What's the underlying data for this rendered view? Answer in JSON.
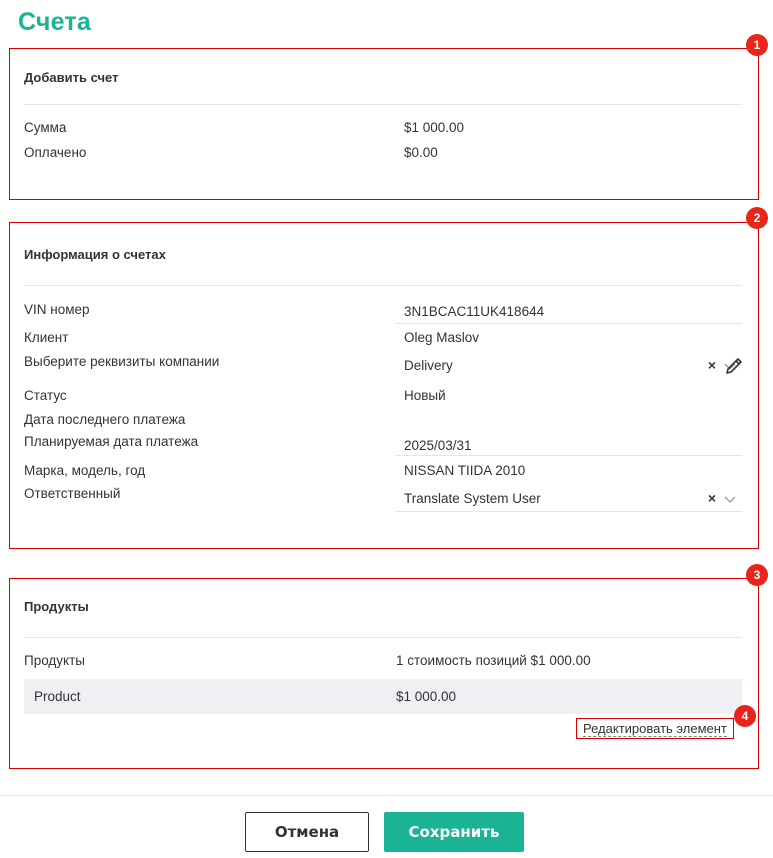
{
  "page": {
    "title": "Счета"
  },
  "add_invoice": {
    "badge": "1",
    "header": "Добавить счет",
    "rows": [
      {
        "label": "Сумма",
        "value": "$1 000.00"
      },
      {
        "label": "Оплачено",
        "value": "$0.00"
      }
    ]
  },
  "invoice_info": {
    "badge": "2",
    "header": "Информация о счетах",
    "vin": {
      "label": "VIN номер",
      "value": "3N1BCAC11UK418644"
    },
    "client": {
      "label": "Клиент",
      "value": "Oleg Maslov"
    },
    "company": {
      "label": "Выберите реквизиты компании",
      "value": "Delivery",
      "clear": "×"
    },
    "status": {
      "label": "Статус",
      "value": "Новый"
    },
    "last_payment": {
      "label": "Дата последнего платежа",
      "value": ""
    },
    "planned_payment": {
      "label": "Планируемая дата платежа",
      "value": "2025/03/31"
    },
    "vehicle": {
      "label": "Марка, модель, год",
      "value": "NISSAN TIIDA 2010"
    },
    "responsible": {
      "label": "Ответственный",
      "value": "Translate System User",
      "clear": "×"
    }
  },
  "products": {
    "badge": "3",
    "header": "Продукты",
    "summary_label": "Продукты",
    "summary_value": "1 стоимость позиций $1 000.00",
    "items": [
      {
        "name": "Product",
        "price": "$1 000.00"
      }
    ],
    "edit_link": "Редактировать элемент",
    "edit_badge": "4"
  },
  "footer": {
    "cancel_label": "Отмена",
    "save_label": "Сохранить"
  },
  "colors": {
    "accent": "#1ab394",
    "annotation_red": "#e8241b"
  }
}
